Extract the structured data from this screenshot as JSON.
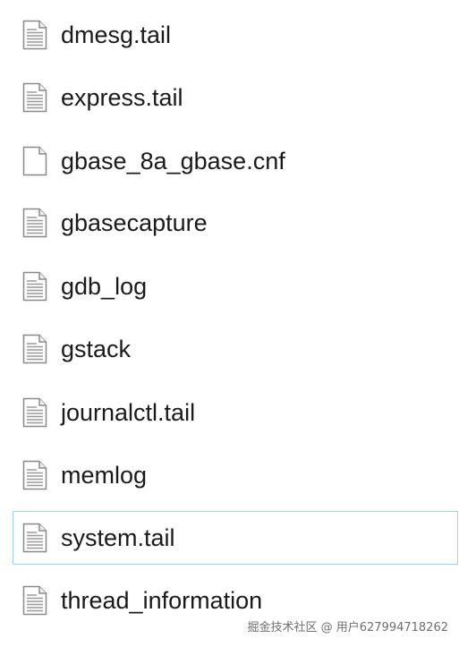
{
  "files": [
    {
      "name": "dmesg.tail",
      "icon": "text-document-icon",
      "selected": false
    },
    {
      "name": "express.tail",
      "icon": "text-document-icon",
      "selected": false
    },
    {
      "name": "gbase_8a_gbase.cnf",
      "icon": "blank-document-icon",
      "selected": false
    },
    {
      "name": "gbasecapture",
      "icon": "text-document-icon",
      "selected": false
    },
    {
      "name": "gdb_log",
      "icon": "text-document-icon",
      "selected": false
    },
    {
      "name": "gstack",
      "icon": "text-document-icon",
      "selected": false
    },
    {
      "name": "journalctl.tail",
      "icon": "text-document-icon",
      "selected": false
    },
    {
      "name": "memlog",
      "icon": "text-document-icon",
      "selected": false
    },
    {
      "name": "system.tail",
      "icon": "text-document-icon",
      "selected": true
    },
    {
      "name": "thread_information",
      "icon": "text-document-icon",
      "selected": false
    }
  ],
  "watermark": "掘金技术社区 @ 用户627994718262",
  "colors": {
    "selection_border": "#99d1ff",
    "text": "#1a1a1a",
    "icon_stroke": "#8a8a8a"
  }
}
